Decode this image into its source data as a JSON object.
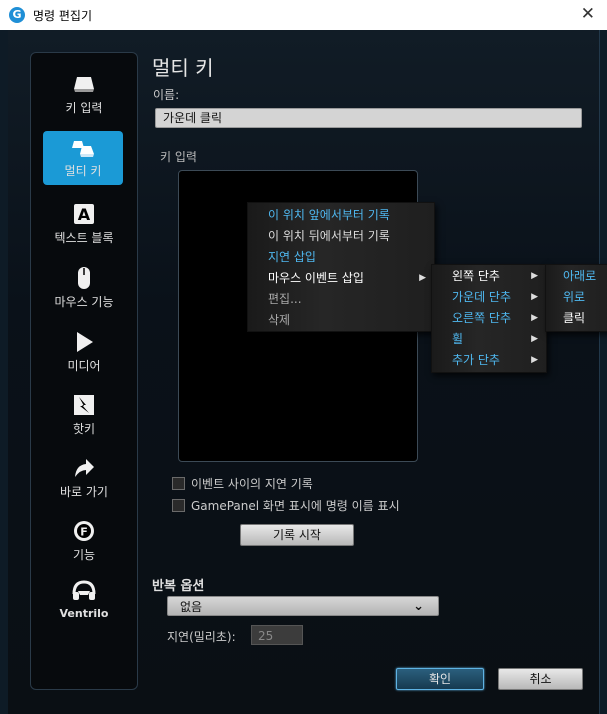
{
  "window": {
    "title": "명령 편집기",
    "logo": "G"
  },
  "sidebar": {
    "items": [
      {
        "label": "키 입력",
        "icon": "keyboard-key-icon"
      },
      {
        "label": "멀티 키",
        "icon": "multi-key-icon",
        "active": true
      },
      {
        "label": "텍스트 블록",
        "icon": "text-block-icon",
        "glyph": "A"
      },
      {
        "label": "마우스 기능",
        "icon": "mouse-icon"
      },
      {
        "label": "미디어",
        "icon": "play-icon"
      },
      {
        "label": "핫키",
        "icon": "hotkey-icon"
      },
      {
        "label": "바로 가기",
        "icon": "shortcut-arrow-icon"
      },
      {
        "label": "기능",
        "icon": "function-gear-icon",
        "glyph": "F"
      },
      {
        "label": "Ventrilo",
        "icon": "headset-icon"
      }
    ]
  },
  "main": {
    "title": "멀티 키",
    "name_label": "이름:",
    "name_value": "가운데 클릭",
    "keys_label": "키 입력"
  },
  "context_menu": {
    "items": [
      {
        "label": "이 위치 앞에서부터 기록",
        "color": "#4fb8f0"
      },
      {
        "label": "이 위치 뒤에서부터 기록",
        "color": "#dddddd"
      },
      {
        "label": "지연 삽입",
        "color": "#4fb8f0"
      },
      {
        "label": "마우스 이벤트 삽입",
        "color": "#ffffff",
        "submenu": true
      },
      {
        "label": "편집...",
        "color": "#aaaaaa"
      },
      {
        "label": "삭제",
        "color": "#aaaaaa"
      }
    ]
  },
  "submenu": {
    "items": [
      {
        "label": "왼쪽 단추",
        "color": "#ffffff",
        "submenu": true
      },
      {
        "label": "가운데 단추",
        "color": "#4fb8f0",
        "submenu": true
      },
      {
        "label": "오른쪽 단추",
        "color": "#4fb8f0",
        "submenu": true
      },
      {
        "label": "휠",
        "color": "#4fb8f0",
        "submenu": true
      },
      {
        "label": "추가 단추",
        "color": "#4fb8f0",
        "submenu": true
      }
    ]
  },
  "subsubmenu": {
    "items": [
      {
        "label": "아래로",
        "color": "#4fb8f0"
      },
      {
        "label": "위로",
        "color": "#4fb8f0"
      },
      {
        "label": "클릭",
        "color": "#ffffff"
      }
    ]
  },
  "options": {
    "record_delay_label": "이벤트 사이의 지연 기록",
    "show_name_label": "GamePanel 화면 표시에 명령 이름 표시",
    "record_start_button": "기록 시작"
  },
  "repeat": {
    "label": "반복 옵션",
    "selected": "없음",
    "delay_label": "지연(밀리초):",
    "delay_value": "25"
  },
  "footer": {
    "ok": "확인",
    "cancel": "취소"
  },
  "colors": {
    "accent": "#1b9ad6",
    "menu_highlight": "#4fb8f0"
  }
}
